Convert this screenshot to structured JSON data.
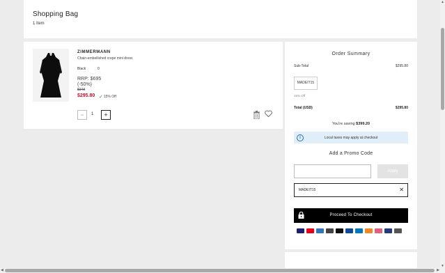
{
  "header": {
    "title": "Shopping Bag",
    "count": "1 Item"
  },
  "item": {
    "brand": "ZIMMERMANN",
    "description": "Chain-embellished crepe mini dress",
    "color": "Black",
    "size": "0",
    "rrp": "RRP: $695",
    "discount": "(-50%)",
    "original_price": "$348",
    "sale_price": "$295.80",
    "percent_off": "15% Off",
    "quantity": "1",
    "minus_label": "−",
    "plus_label": "+"
  },
  "summary": {
    "title": "Order Summary",
    "subtotal_label": "Sub-Total",
    "subtotal_value": "$295.80",
    "promo_chip": "MADEIT15",
    "promo_percent": "15% Off",
    "total_label": "Total (USD)",
    "total_value": "$295.80",
    "saving_prefix": "You're saving",
    "saving_amount": "$399.20",
    "info_text": "Local taxes may apply at checkout",
    "promo_title": "Add a Promo Code",
    "apply_label": "Apply",
    "applied_code": "MADEIT15",
    "checkout_label": "Proceed To Checkout"
  },
  "payments": [
    {
      "icon": "visa-icon",
      "color": "#1a1f71"
    },
    {
      "icon": "mastercard-icon",
      "color": "#eb001b"
    },
    {
      "icon": "amex-icon",
      "color": "#2e77bb"
    },
    {
      "icon": "card-icon",
      "color": "#444444"
    },
    {
      "icon": "applepay-icon",
      "color": "#111111"
    },
    {
      "icon": "unionpay-icon",
      "color": "#0e4c96"
    },
    {
      "icon": "diners-icon",
      "color": "#0079be"
    },
    {
      "icon": "discover-icon",
      "color": "#f08a24"
    },
    {
      "icon": "klarna-icon",
      "color": "#e0607e"
    },
    {
      "icon": "paypal-icon",
      "color": "#253b80"
    },
    {
      "icon": "afterpay-icon",
      "color": "#555555"
    }
  ]
}
